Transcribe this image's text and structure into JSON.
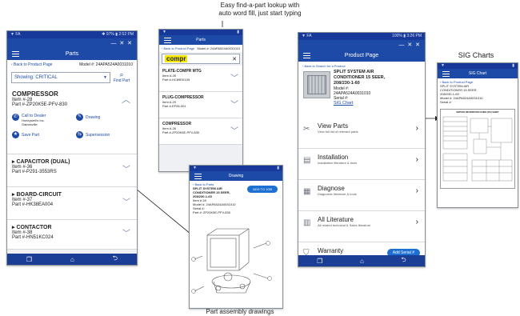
{
  "captions": {
    "lookup": "Easy find-a-part lookup with\nauto word fill, just start typing",
    "sig": "SIG Charts",
    "drawings": "Part assembly drawings"
  },
  "phone1": {
    "status_left": "▼ FA",
    "status_right": "✱ 97% ▮ 2:52 PM",
    "title": "Parts",
    "back_link": "‹ Back to Product Page",
    "model": "Model #: 24APA524A0031010",
    "showing": "Showing: CRITICAL",
    "find_part": "Find Part",
    "compressor": {
      "heading": "COMPRESSOR",
      "item": "Item #-28",
      "part": "Part #-ZP20K5E-PFV-830",
      "call_dealer": "Call to Dealer",
      "dealer_name": "Honeywell's Inc.\nGainesville",
      "drawing": "Drawing",
      "save_part": "Save Part",
      "supersession": "Supersession"
    },
    "items": [
      {
        "heading": "▸ CAPACITOR (DUAL)",
        "item": "Item #-36",
        "part": "Part #-P291-3553RS"
      },
      {
        "heading": "▸ BOARD-CIRCUIT",
        "item": "Item #-37",
        "part": "Part #-HK38EA004"
      },
      {
        "heading": "▸ CONTACTOR",
        "item": "Item #-38",
        "part": "Part #-HN51KC024"
      }
    ]
  },
  "phone2": {
    "title": "Parts",
    "back_link": "‹ Back to Product Page",
    "model": "Model #: 24APA524A0031010",
    "search_value": "compr",
    "results": [
      {
        "name": "PLATE-COMPR MTG",
        "item": "Item #-28",
        "part": "Part #-HC89EK105"
      },
      {
        "name": "PLUG-COMPRESSOR",
        "item": "Item #-29",
        "part": "Part #-EF06-001"
      },
      {
        "name": "COMPRESSOR",
        "item": "Item #-28",
        "part": "Part #-ZP20K5E-PFV-830"
      }
    ]
  },
  "phone3": {
    "title": "Drawing",
    "back_link": "‹ Back to Parts",
    "product": "SPLIT SYSTEM AIR\nCONDITIONER 15 SEER,\n208/230-1-60",
    "item": "Item # 28",
    "model": "Model #: 24APA524A0031010",
    "serial": "Serial #:",
    "part": "Part #: ZP20K5E-PFV-830",
    "add_button": "ADD TO JOB"
  },
  "phone4": {
    "status_left": "▼ FA",
    "status_right": "100% ▮ 3:26 PM",
    "title": "Product Page",
    "back_link": "‹ Back to Search for a Product",
    "product": "SPLIT SYSTEM AIR\nCONDITIONER 15 SEER,\n208/230-1-60",
    "model_label": "Model #:",
    "model": "24APA524A0031010",
    "serial": "Serial #:",
    "sig_chart": "SIG Chart",
    "menu": [
      {
        "title": "View Parts",
        "sub": "View full list of relevant parts"
      },
      {
        "title": "Installation",
        "sub": "Installation literature & tools"
      },
      {
        "title": "Diagnose",
        "sub": "Diagnostic literature & tools"
      },
      {
        "title": "All Literature",
        "sub": "All related technical & Sales literature"
      },
      {
        "title": "Warranty",
        "sub": "Warranty Info for Product"
      }
    ],
    "add_serial": "Add Serial #"
  },
  "phone5": {
    "title": "SIG Chart",
    "back_link": "‹ Back to Product Page",
    "product": "SPLIT SYSTEM AIR\nCONDITIONER 15 SEER,\n208/230-1-60",
    "model": "Model #: 24APA524A0031010",
    "serial": "Serial #:",
    "chart_title": "SERVICE INFORMATION GUIDE (SIG) SHEET"
  },
  "colors": {
    "primary": "#1d4aa6",
    "status": "#16399a",
    "accent": "#1d6fd1",
    "search_highlight": "#f5e600"
  }
}
